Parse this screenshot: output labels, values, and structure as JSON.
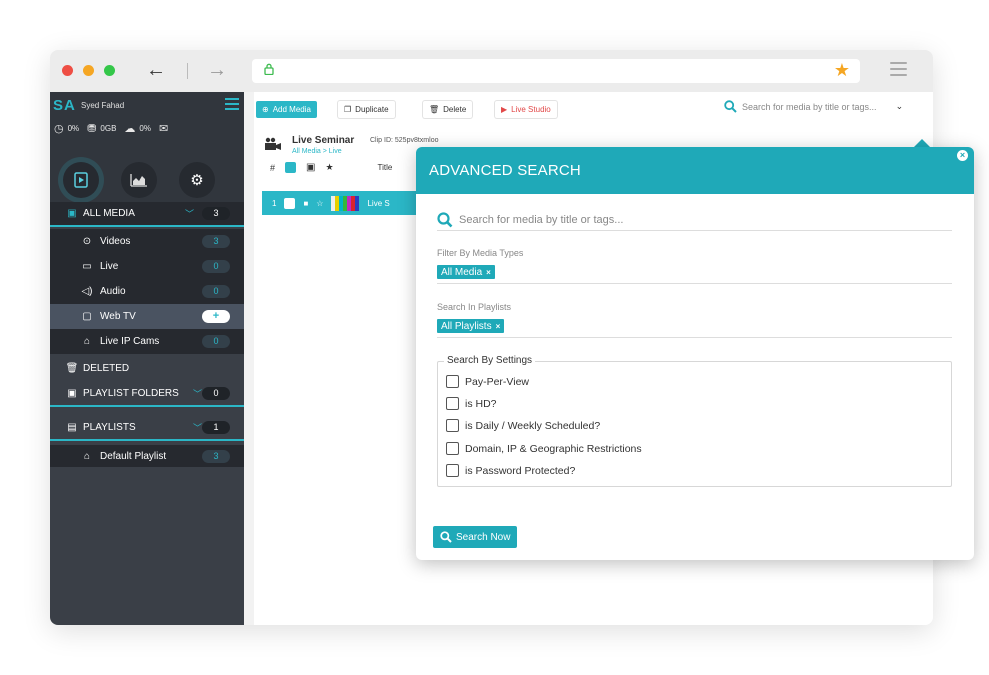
{
  "browser": {
    "back_icon": "←",
    "forward_icon": "→",
    "bookmark_icon": "★"
  },
  "sidebar": {
    "initials": "SA",
    "user_name": "Syed Fahad",
    "stats": {
      "cpu": "0%",
      "storage": "0GB",
      "bandwidth": "0%"
    },
    "items": [
      {
        "label": "ALL MEDIA",
        "count": "3"
      },
      {
        "label": "Videos",
        "count": "3"
      },
      {
        "label": "Live",
        "count": "0"
      },
      {
        "label": "Audio",
        "count": "0"
      },
      {
        "label": "Web TV",
        "count": "+"
      },
      {
        "label": "Live IP Cams",
        "count": "0"
      },
      {
        "label": "DELETED",
        "count": ""
      },
      {
        "label": "PLAYLIST FOLDERS",
        "count": "0"
      },
      {
        "label": "PLAYLISTS",
        "count": "1"
      },
      {
        "label": "Default Playlist",
        "count": "3"
      }
    ],
    "colors": {
      "bg": "#3a3f47",
      "accent": "#2bb7c7"
    }
  },
  "toolbar": {
    "add_media": "Add Media",
    "duplicate": "Duplicate",
    "delete": "Delete",
    "live_studio": "Live Studio",
    "search_placeholder": "Search for media by title or tags..."
  },
  "content": {
    "title": "Live Seminar",
    "clip_id": "Clip ID: 525pv8txmloo",
    "breadcrumb": "All Media > Live",
    "header_hash": "#",
    "header_title": "Title",
    "row_number": "1",
    "row_title": "Live S"
  },
  "advanced_search": {
    "title": "ADVANCED SEARCH",
    "search_placeholder": "Search for media by title or tags...",
    "media_types_label": "Filter By Media Types",
    "media_types_chip": "All Media",
    "playlists_label": "Search In Playlists",
    "playlists_chip": "All Playlists",
    "settings_legend": "Search By Settings",
    "options": [
      "Pay-Per-View",
      "is HD?",
      "is Daily / Weekly Scheduled?",
      "Domain, IP & Geographic Restrictions",
      "is Password Protected?"
    ],
    "search_button": "Search Now",
    "chip_remove": "×",
    "close_glyph": "×",
    "accent": "#1fa9b8"
  }
}
